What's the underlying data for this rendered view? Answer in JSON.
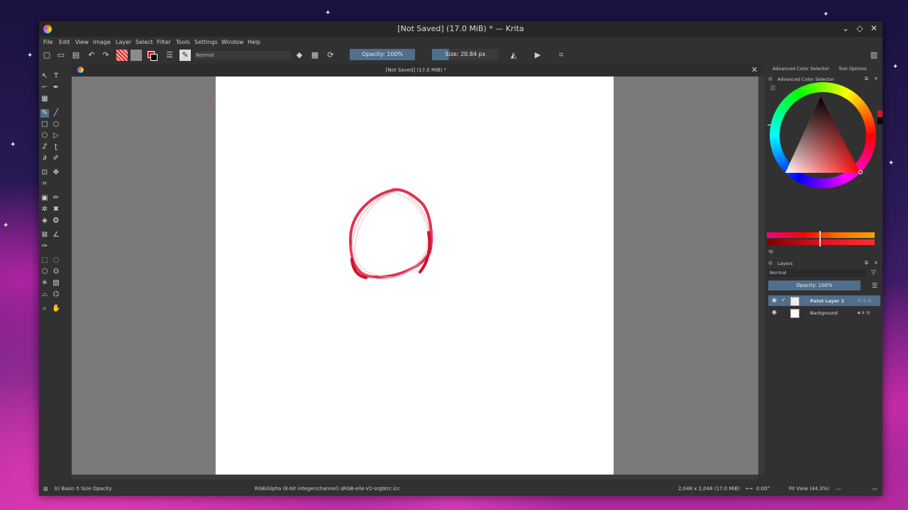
{
  "window": {
    "title": "[Not Saved] (17.0 MiB) * — Krita",
    "controls": {
      "minimize": "⌄",
      "maximize": "◇",
      "close": "✕"
    }
  },
  "menu": [
    "File",
    "Edit",
    "View",
    "Image",
    "Layer",
    "Select",
    "Filter",
    "Tools",
    "Settings",
    "Window",
    "Help"
  ],
  "toolbar": {
    "blend_mode": "Normal",
    "opacity_label": "Opacity: 100%",
    "size_label": "Size: 20.84 px"
  },
  "document_tab": {
    "title": "[Not Saved]  (17.0 MiB) *",
    "close": "✕"
  },
  "dock": {
    "tabs": [
      "Advanced Color Selector",
      "Tool Options"
    ],
    "color_selector_title": "Advanced Color Selector",
    "layers_title": "Layers",
    "layers_blend": "Normal",
    "layers_opacity": "Opacity: 100%",
    "layers": [
      {
        "name": "Paint Layer 1",
        "selected": true
      },
      {
        "name": "Background",
        "selected": false
      }
    ]
  },
  "statusbar": {
    "brush_preset": "b) Basic-5 Size Opacity",
    "color_profile": "RGB/Alpha (8-bit integer/channel)  sRGB-elle-V2-srgbtrc.icc",
    "image_size": "2,048 x 2,048 (17.0 MiB)",
    "rotation": "0.00°",
    "zoom": "Fit View (44.3%)"
  },
  "colors": {
    "accent": "#4f6f8c",
    "foreground": "#e01020",
    "stroke": "#dc1e3c"
  }
}
